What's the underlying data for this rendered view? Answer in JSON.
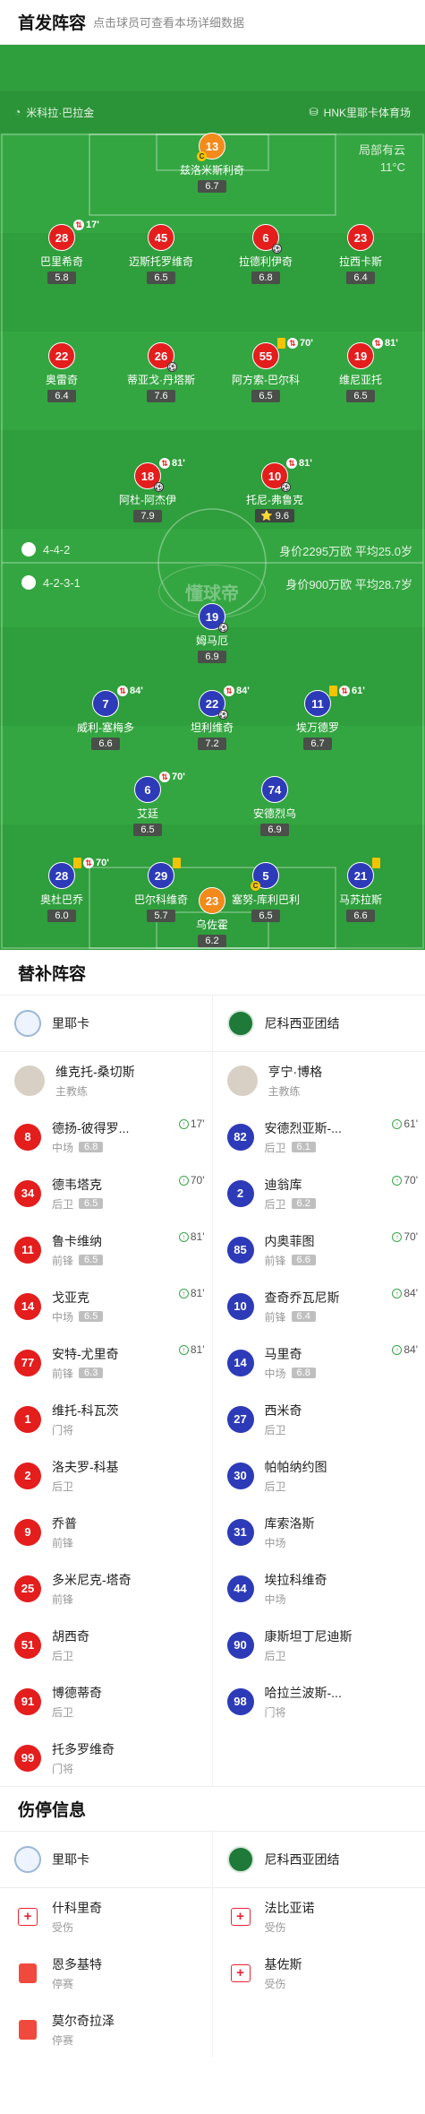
{
  "header": {
    "title": "首发阵容",
    "subtitle": "点击球员可查看本场详细数据"
  },
  "venue": {
    "referee": "米科拉·巴拉金",
    "stadium": "HNK里耶卡体育场"
  },
  "weather": {
    "condition": "局部有云",
    "temperature": "11°C"
  },
  "watermark": "懂球帝",
  "home": {
    "formation": "4-4-2",
    "value_label": "身价2295万欧 平均25.0岁",
    "players": [
      {
        "num": "13",
        "name": "兹洛米斯利奇",
        "rating": "6.7",
        "color": "orange",
        "captain": "C"
      },
      {
        "num": "28",
        "name": "巴里希奇",
        "rating": "5.8",
        "color": "red",
        "event_time": "17'"
      },
      {
        "num": "45",
        "name": "迈斯托罗维奇",
        "rating": "6.5",
        "color": "red"
      },
      {
        "num": "6",
        "name": "拉德利伊奇",
        "rating": "6.8",
        "color": "red",
        "ball": true
      },
      {
        "num": "23",
        "name": "拉西卡斯",
        "rating": "6.4",
        "color": "red"
      },
      {
        "num": "22",
        "name": "奥雷奇",
        "rating": "6.4",
        "color": "red"
      },
      {
        "num": "26",
        "name": "蒂亚戈·丹塔斯",
        "rating": "7.6",
        "color": "red",
        "ball": true
      },
      {
        "num": "55",
        "name": "阿方索-巴尔科",
        "rating": "6.5",
        "color": "red",
        "event_time": "70'",
        "card": "yellow"
      },
      {
        "num": "19",
        "name": "维尼亚托",
        "rating": "6.5",
        "color": "red",
        "event_time": "81'"
      },
      {
        "num": "18",
        "name": "阿杜-阿杰伊",
        "rating": "7.9",
        "color": "red",
        "event_time": "81'",
        "ball": true
      },
      {
        "num": "10",
        "name": "托尼-弗鲁克",
        "rating": "9.6",
        "color": "red",
        "event_time": "81'",
        "ball": true,
        "star": "⭐"
      }
    ]
  },
  "away": {
    "formation": "4-2-3-1",
    "value_label": "身价900万欧 平均28.7岁",
    "players": [
      {
        "num": "19",
        "name": "姆马厄",
        "rating": "6.9",
        "color": "blue",
        "ball": true
      },
      {
        "num": "7",
        "name": "威利-塞梅多",
        "rating": "6.6",
        "color": "blue",
        "event_time": "84'"
      },
      {
        "num": "22",
        "name": "坦利维奇",
        "rating": "7.2",
        "color": "blue",
        "event_time": "84'",
        "ball": true
      },
      {
        "num": "11",
        "name": "埃万德罗",
        "rating": "6.7",
        "color": "blue",
        "event_time": "61'",
        "card": "yellow"
      },
      {
        "num": "6",
        "name": "艾廷",
        "rating": "6.5",
        "color": "blue",
        "event_time": "70'"
      },
      {
        "num": "74",
        "name": "安德烈乌",
        "rating": "6.9",
        "color": "blue"
      },
      {
        "num": "28",
        "name": "奥杜巴乔",
        "rating": "6.0",
        "color": "blue",
        "event_time": "70'",
        "card": "yellow"
      },
      {
        "num": "29",
        "name": "巴尔科维奇",
        "rating": "5.7",
        "color": "blue",
        "card": "yellow"
      },
      {
        "num": "5",
        "name": "塞努-库利巴利",
        "rating": "6.5",
        "color": "blue",
        "captain": "C"
      },
      {
        "num": "21",
        "name": "马苏拉斯",
        "rating": "6.6",
        "color": "blue",
        "card": "yellow"
      },
      {
        "num": "23",
        "name": "乌佐霍",
        "rating": "6.2",
        "color": "orange"
      }
    ]
  },
  "subs_section": {
    "title": "替补阵容"
  },
  "subs": {
    "home": {
      "team": "里耶卡",
      "coach": {
        "name": "维克托-桑切斯",
        "role": "主教练"
      },
      "players": [
        {
          "num": "8",
          "name": "德扬-彼得罗...",
          "pos": "中场",
          "rating": "6.8",
          "sub_time": "17'"
        },
        {
          "num": "34",
          "name": "德韦塔克",
          "pos": "后卫",
          "rating": "6.5",
          "sub_time": "70'"
        },
        {
          "num": "11",
          "name": "鲁卡维纳",
          "pos": "前锋",
          "rating": "6.5",
          "sub_time": "81'"
        },
        {
          "num": "14",
          "name": "戈亚克",
          "pos": "中场",
          "rating": "6.5",
          "sub_time": "81'"
        },
        {
          "num": "77",
          "name": "安特-尤里奇",
          "pos": "前锋",
          "rating": "6.3",
          "sub_time": "81'"
        },
        {
          "num": "1",
          "name": "维托-科瓦茨",
          "pos": "门将"
        },
        {
          "num": "2",
          "name": "洛夫罗-科基",
          "pos": "后卫"
        },
        {
          "num": "9",
          "name": "乔普",
          "pos": "前锋"
        },
        {
          "num": "25",
          "name": "多米尼克-塔奇",
          "pos": "前锋"
        },
        {
          "num": "51",
          "name": "胡西奇",
          "pos": "后卫"
        },
        {
          "num": "91",
          "name": "博德蒂奇",
          "pos": "后卫"
        },
        {
          "num": "99",
          "name": "托多罗维奇",
          "pos": "门将"
        }
      ]
    },
    "away": {
      "team": "尼科西亚团结",
      "coach": {
        "name": "亨宁·博格",
        "role": "主教练"
      },
      "players": [
        {
          "num": "82",
          "name": "安德烈亚斯-...",
          "pos": "后卫",
          "rating": "6.1",
          "sub_time": "61'"
        },
        {
          "num": "2",
          "name": "迪翁库",
          "pos": "后卫",
          "rating": "6.2",
          "sub_time": "70'"
        },
        {
          "num": "85",
          "name": "内奥菲图",
          "pos": "前锋",
          "rating": "6.6",
          "sub_time": "70'"
        },
        {
          "num": "10",
          "name": "查奇乔瓦尼斯",
          "pos": "前锋",
          "rating": "6.4",
          "sub_time": "84'"
        },
        {
          "num": "14",
          "name": "马里奇",
          "pos": "中场",
          "rating": "6.8",
          "sub_time": "84'"
        },
        {
          "num": "27",
          "name": "西米奇",
          "pos": "后卫"
        },
        {
          "num": "30",
          "name": "帕帕纳约图",
          "pos": "后卫"
        },
        {
          "num": "31",
          "name": "库索洛斯",
          "pos": "中场"
        },
        {
          "num": "44",
          "name": "埃拉科维奇",
          "pos": "中场"
        },
        {
          "num": "90",
          "name": "康斯坦丁尼迪斯",
          "pos": "后卫"
        },
        {
          "num": "98",
          "name": "哈拉兰波斯-...",
          "pos": "门将"
        }
      ]
    }
  },
  "injury_section": {
    "title": "伤停信息"
  },
  "injuries": {
    "home": {
      "team": "里耶卡",
      "players": [
        {
          "name": "什科里奇",
          "status": "受伤",
          "icon": "cross"
        },
        {
          "name": "恩多基特",
          "status": "停赛",
          "icon": "redcard"
        },
        {
          "name": "莫尔奇拉泽",
          "status": "停赛",
          "icon": "redcard"
        }
      ]
    },
    "away": {
      "team": "尼科西亚团结",
      "players": [
        {
          "name": "法比亚诺",
          "status": "受伤",
          "icon": "cross"
        },
        {
          "name": "基佐斯",
          "status": "受伤",
          "icon": "cross"
        }
      ]
    }
  },
  "colors": {
    "pitch": "#2f9e3c",
    "home": "#e41d1d",
    "away": "#2d3bb8",
    "keeper": "#f28a1c"
  }
}
